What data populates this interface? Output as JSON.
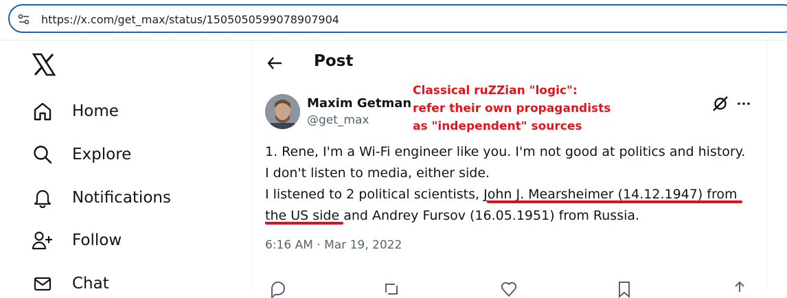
{
  "browser": {
    "url": "https://x.com/get_max/status/1505050599078907904"
  },
  "sidebar": {
    "logo": "x-logo-icon",
    "items": [
      {
        "label": "Home",
        "icon": "home-icon"
      },
      {
        "label": "Explore",
        "icon": "search-icon"
      },
      {
        "label": "Notifications",
        "icon": "bell-icon"
      },
      {
        "label": "Follow",
        "icon": "add-user-icon"
      },
      {
        "label": "Chat",
        "icon": "mail-icon"
      }
    ]
  },
  "header": {
    "title": "Post"
  },
  "post": {
    "author_name": "Maxim Getman",
    "author_handle": "@get_max",
    "text_lines": [
      "1. Rene, I'm a Wi-Fi engineer like you. I'm not good at politics and history.",
      "I don't listen to media, either side."
    ],
    "line3_prefix": "I listened to 2 political scientists, ",
    "line3_link": "John J. Mearsheimer (14.12.1947) from",
    "line4_link": "the US side",
    "line4_suffix": " and Andrey Fursov (16.05.1951) from Russia.",
    "timestamp": "6:16 AM · Mar 19, 2022"
  },
  "annotation": {
    "lines": [
      "Classical ruZZian \"logic\":",
      "refer their own propagandists",
      "as \"independent\" sources"
    ],
    "color": "#e8121a"
  },
  "colors": {
    "url_border": "#1a5fb4",
    "text": "#0f1419",
    "muted": "#536471",
    "underline_red": "#e0101a"
  }
}
